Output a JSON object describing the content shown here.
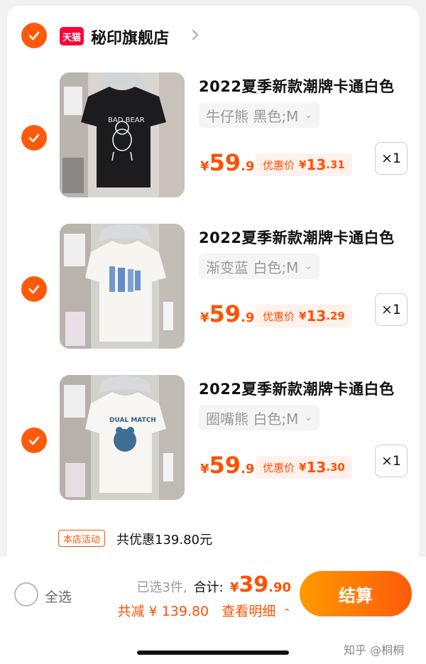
{
  "shop": {
    "badge": "天猫",
    "name": "秘印旗舰店",
    "checked": true
  },
  "items": [
    {
      "title": "2022夏季新款潮牌卡通白色",
      "sku": "牛仔熊 黑色;M",
      "price_currency": "¥",
      "price_int": "59",
      "price_dec": ".9",
      "promo_label": "优惠价",
      "promo_currency": "¥",
      "promo_int": "13",
      "promo_dec": ".31",
      "qty": "×1",
      "image_print": "BAD BEAR",
      "checked": true
    },
    {
      "title": "2022夏季新款潮牌卡通白色",
      "sku": "渐变蓝 白色;M",
      "price_currency": "¥",
      "price_int": "59",
      "price_dec": ".9",
      "promo_label": "优惠价",
      "promo_currency": "¥",
      "promo_int": "13",
      "promo_dec": ".29",
      "qty": "×1",
      "checked": true
    },
    {
      "title": "2022夏季新款潮牌卡通白色",
      "sku": "圈嘴熊 白色;M",
      "price_currency": "¥",
      "price_int": "59",
      "price_dec": ".9",
      "promo_label": "优惠价",
      "promo_currency": "¥",
      "promo_int": "13",
      "promo_dec": ".30",
      "qty": "×1",
      "image_print": "DUAL MATCH",
      "checked": true
    }
  ],
  "activity": {
    "badge": "本店活动",
    "text": "共优惠139.80元"
  },
  "bottom": {
    "select_all": "全选",
    "selected": "已选3件,",
    "total_label": "合计:",
    "total_currency": "¥",
    "total_int": "39",
    "total_dec": ".90",
    "discount": "共减 ¥ 139.80",
    "detail": "查看明细",
    "checkout": "结算",
    "watermark": "知乎 @桐桐"
  },
  "colors": {
    "accent": "#ff5000",
    "check": "#ff5a0a",
    "tmall": "#ff0036"
  }
}
